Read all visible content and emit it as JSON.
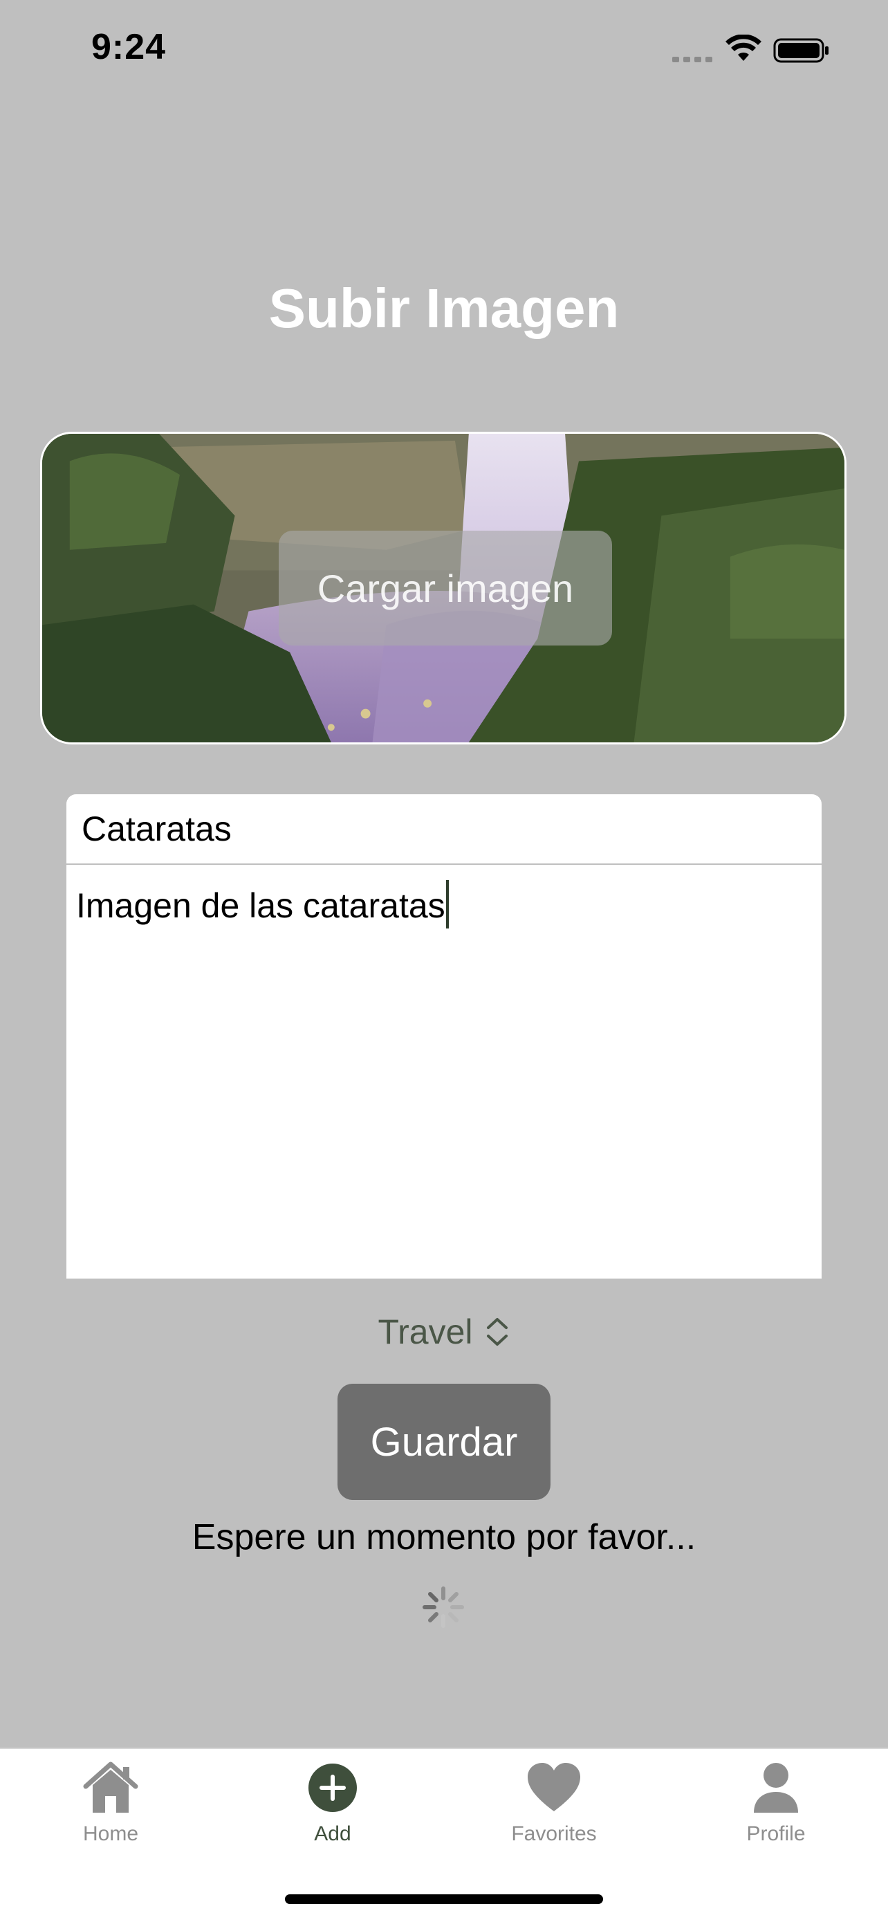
{
  "status_bar": {
    "time": "9:24"
  },
  "page": {
    "title": "Subir Imagen"
  },
  "image_picker": {
    "button_label": "Cargar imagen"
  },
  "form": {
    "title_value": "Cataratas",
    "description_value": "Imagen de las cataratas",
    "category": "Travel"
  },
  "actions": {
    "save_label": "Guardar"
  },
  "loading": {
    "message": "Espere un momento por favor..."
  },
  "tab_bar": {
    "items": [
      {
        "label": "Home",
        "icon": "house-icon",
        "active": false
      },
      {
        "label": "Add",
        "icon": "plus-circle-icon",
        "active": true
      },
      {
        "label": "Favorites",
        "icon": "heart-icon",
        "active": false
      },
      {
        "label": "Profile",
        "icon": "person-icon",
        "active": false
      }
    ]
  },
  "colors": {
    "background": "#bfbfbf",
    "accent": "#3f4f3c",
    "button": "#6e6e6e",
    "tab_inactive": "#8e8e8e"
  }
}
